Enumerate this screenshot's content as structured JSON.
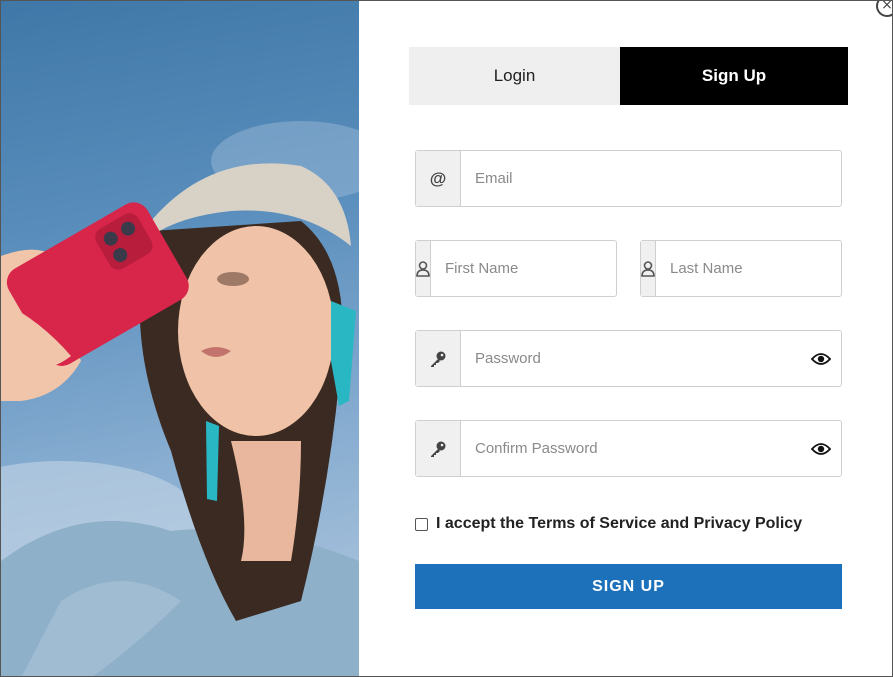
{
  "colors": {
    "tab_active_bg": "#000000",
    "tab_inactive_bg": "#efefef",
    "primary_button": "#1d71bb",
    "addon_bg": "#f0f0f0",
    "phone_case": "#d8254a",
    "earring": "#2ab7c4"
  },
  "photo": {
    "alt": "Woman holding a red phone case against a blue sky"
  },
  "close": {
    "icon": "close-icon",
    "glyph": "×"
  },
  "tabs": [
    {
      "label": "Login",
      "active": false
    },
    {
      "label": "Sign Up",
      "active": true
    }
  ],
  "form": {
    "email": {
      "icon": "at-icon",
      "glyph": "@",
      "placeholder": "Email",
      "value": ""
    },
    "first_name": {
      "icon": "user-icon",
      "placeholder": "First Name",
      "value": ""
    },
    "last_name": {
      "icon": "user-icon",
      "placeholder": "Last Name",
      "value": ""
    },
    "password": {
      "icon": "key-icon",
      "placeholder": "Password",
      "value": "",
      "toggle_icon": "eye-icon"
    },
    "confirm_password": {
      "icon": "key-icon",
      "placeholder": "Confirm Password",
      "value": "",
      "toggle_icon": "eye-icon"
    },
    "terms_label": "I accept the Terms of Service and Privacy Policy",
    "terms_checked": false,
    "submit_label": "SIGN UP"
  }
}
